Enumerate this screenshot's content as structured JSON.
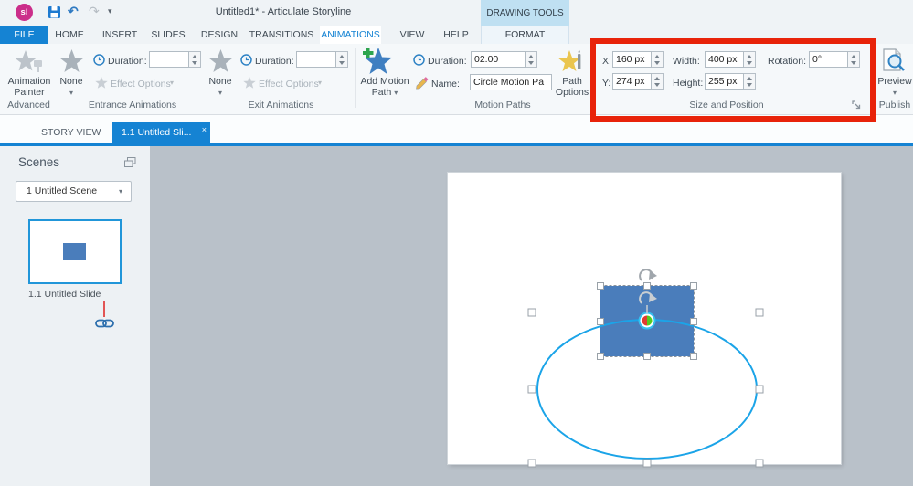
{
  "titlebar": {
    "logo": "sl",
    "title": "Untitled1* - Articulate Storyline"
  },
  "glyphs": {
    "caret": "▾",
    "close": "×",
    "undo": "↶",
    "redo": "↷"
  },
  "ribbon_tabs": [
    "FILE",
    "HOME",
    "INSERT",
    "SLIDES",
    "DESIGN",
    "TRANSITIONS",
    "ANIMATIONS",
    "VIEW",
    "HELP"
  ],
  "contextual": {
    "group_label": "DRAWING TOOLS",
    "tab_label": "FORMAT"
  },
  "ribbon": {
    "advanced": {
      "button_label": "Animation Painter",
      "group_label": "Advanced"
    },
    "entrance": {
      "none_label": "None",
      "duration_label": "Duration:",
      "duration_value": "",
      "effect_options_label": "Effect Options",
      "group_label": "Entrance Animations"
    },
    "exit": {
      "none_label": "None",
      "duration_label": "Duration:",
      "duration_value": "",
      "effect_options_label": "Effect Options",
      "group_label": "Exit Animations"
    },
    "motion_paths": {
      "add_button_label": "Add Motion Path",
      "duration_label": "Duration:",
      "duration_value": "02.00",
      "name_label": "Name:",
      "name_value": "Circle Motion Pa",
      "path_options_label": "Path Options",
      "group_label": "Motion Paths"
    },
    "size_position": {
      "x_label": "X:",
      "x_value": "160 px",
      "y_label": "Y:",
      "y_value": "274 px",
      "width_label": "Width:",
      "width_value": "400 px",
      "height_label": "Height:",
      "height_value": "255 px",
      "rotation_label": "Rotation:",
      "rotation_value": "0°",
      "group_label": "Size and Position"
    },
    "publish": {
      "preview_label": "Preview",
      "group_label": "Publish"
    }
  },
  "view_tabs": {
    "story_view_label": "STORY VIEW",
    "slide_tab_label": "1.1 Untitled Sli..."
  },
  "scenes_panel": {
    "header": "Scenes",
    "scene_selector_value": "1 Untitled Scene",
    "slide_label": "1.1 Untitled Slide"
  },
  "colors": {
    "accent_blue": "#1583d3",
    "highlight_red": "#e8230a",
    "shape_fill": "#4a7dbb",
    "motion_path_stroke": "#1ba4e8",
    "start_point_red": "#e03c31",
    "start_point_green": "#55cc1e",
    "logo_pink": "#cb2e8a",
    "canvas_gray": "#b9c1c9"
  }
}
